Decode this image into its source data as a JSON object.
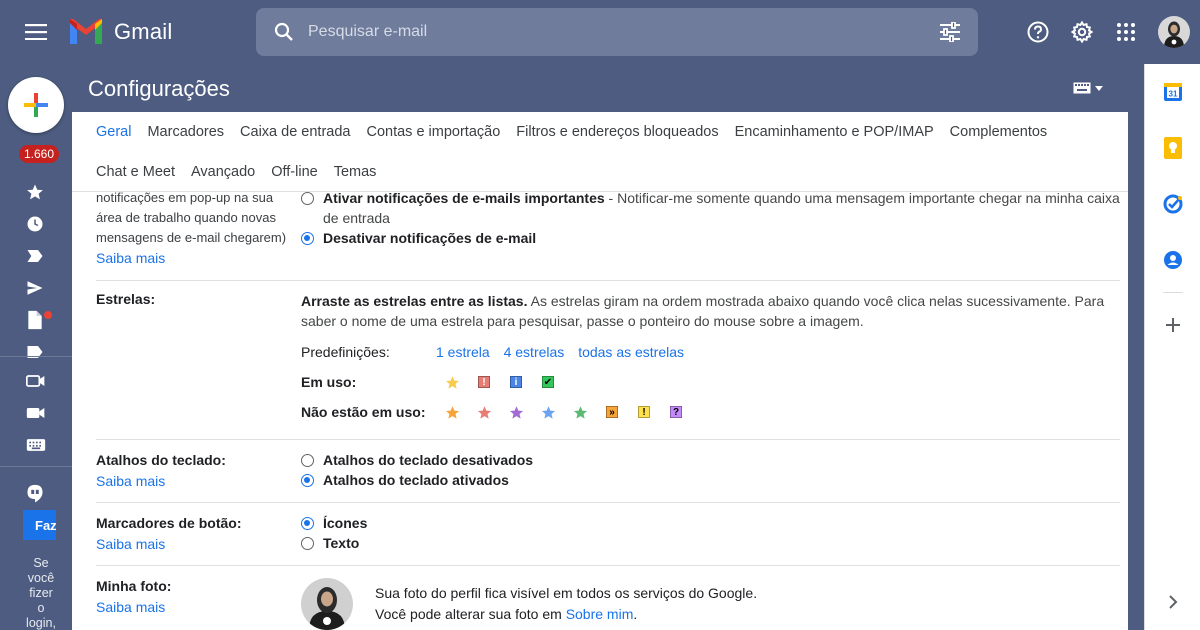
{
  "app": {
    "name": "Gmail"
  },
  "search": {
    "placeholder": "Pesquisar e-mail"
  },
  "colors": {
    "accent": "#1a73e8",
    "header": "#4d5c80"
  },
  "left_rail": {
    "unread_count": "1.660",
    "fab_label": "Faz",
    "login_prompt": "Se você fizer o login,"
  },
  "settings": {
    "title": "Configurações",
    "tabs": [
      {
        "label": "Geral",
        "active": true
      },
      {
        "label": "Marcadores"
      },
      {
        "label": "Caixa de entrada"
      },
      {
        "label": "Contas e importação"
      },
      {
        "label": "Filtros e endereços bloqueados"
      },
      {
        "label": "Encaminhamento e POP/IMAP"
      },
      {
        "label": "Complementos"
      },
      {
        "label": "Chat e Meet"
      },
      {
        "label": "Avançado"
      },
      {
        "label": "Off-line"
      },
      {
        "label": "Temas"
      }
    ],
    "notifications": {
      "desc": "notificações em pop-up na sua área de trabalho quando novas mensagens de e-mail chegarem)",
      "learn_more": "Saiba mais",
      "opt_important_bold": "Ativar notificações de e-mails importantes",
      "opt_important_rest": " - Notificar-me somente quando uma mensagem importante chegar na minha caixa de entrada",
      "opt_off": "Desativar notificações de e-mail"
    },
    "stars": {
      "label": "Estrelas:",
      "intro_bold": "Arraste as estrelas entre as listas.",
      "intro_rest": " As estrelas giram na ordem mostrada abaixo quando você clica nelas sucessivamente. Para saber o nome de uma estrela para pesquisar, passe o ponteiro do mouse sobre a imagem.",
      "presets_label": "Predefinições:",
      "preset_1": "1 estrela",
      "preset_4": "4 estrelas",
      "preset_all": "todas as estrelas",
      "in_use_label": "Em uso:",
      "not_in_use_label": "Não estão em uso:"
    },
    "shortcuts": {
      "label": "Atalhos do teclado:",
      "learn_more": "Saiba mais",
      "opt_off": "Atalhos do teclado desativados",
      "opt_on": "Atalhos do teclado ativados"
    },
    "button_labels": {
      "label": "Marcadores de botão:",
      "learn_more": "Saiba mais",
      "opt_icons": "Ícones",
      "opt_text": "Texto"
    },
    "photo": {
      "label": "Minha foto:",
      "learn_more": "Saiba mais",
      "line1": "Sua foto do perfil fica visível em todos os serviços do Google.",
      "line2_prefix": "Você pode alterar sua foto em ",
      "line2_link": "Sobre mim",
      "line2_suffix": "."
    }
  }
}
